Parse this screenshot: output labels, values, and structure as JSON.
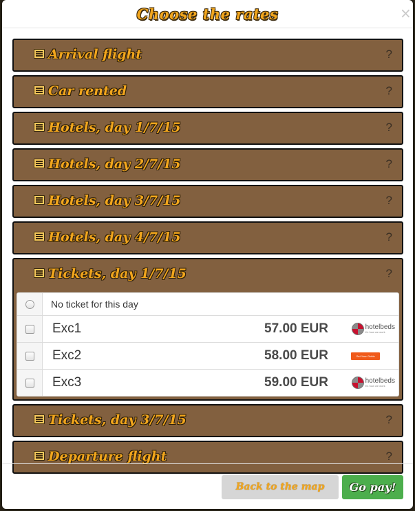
{
  "modal": {
    "title": "Choose the rates",
    "close_glyph": "×"
  },
  "panels": [
    {
      "title": "Arrival flight",
      "help": "?"
    },
    {
      "title": "Car rented",
      "help": "?"
    },
    {
      "title": "Hotels, day 1/7/15",
      "help": "?"
    },
    {
      "title": "Hotels, day 2/7/15",
      "help": "?"
    },
    {
      "title": "Hotels, day 3/7/15",
      "help": "?"
    },
    {
      "title": "Hotels, day 4/7/15",
      "help": "?"
    },
    {
      "title": "Tickets, day 1/7/15",
      "help": "?",
      "expanded": true
    },
    {
      "title": "Tickets, day 3/7/15",
      "help": "?"
    },
    {
      "title": "Departure flight",
      "help": "?"
    }
  ],
  "tickets": {
    "none_label": "No ticket for this day",
    "rows": [
      {
        "name": "Exc1",
        "price": "57.00 EUR",
        "provider": "hotelbeds"
      },
      {
        "name": "Exc2",
        "price": "58.00 EUR",
        "provider": "orange-badge"
      },
      {
        "name": "Exc3",
        "price": "59.00 EUR",
        "provider": "hotelbeds"
      }
    ],
    "hotelbeds_logo": {
      "name": "hotelbeds",
      "tagline": "it's how we work"
    },
    "orange_logo_text": "Get Your Guide"
  },
  "footer": {
    "back_label": "Back to the map",
    "go_label": "Go pay!"
  },
  "colors": {
    "panel_bg": "#82603f",
    "title_orange": "#f2a61d",
    "go_green": "#4cae4c",
    "back_gray": "#d6d6d6"
  }
}
